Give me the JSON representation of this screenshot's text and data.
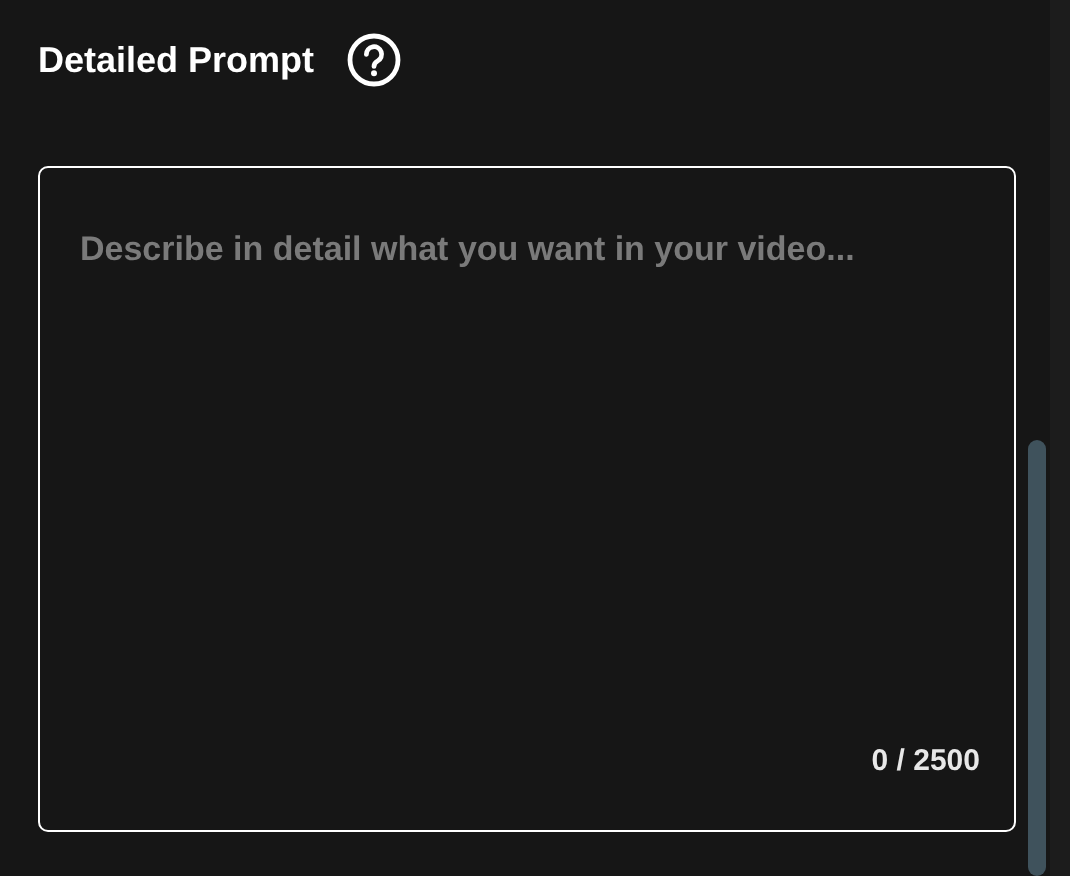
{
  "section": {
    "title": "Detailed Prompt"
  },
  "prompt": {
    "placeholder": "Describe in detail what you want in your video...",
    "counter": "0 / 2500"
  }
}
